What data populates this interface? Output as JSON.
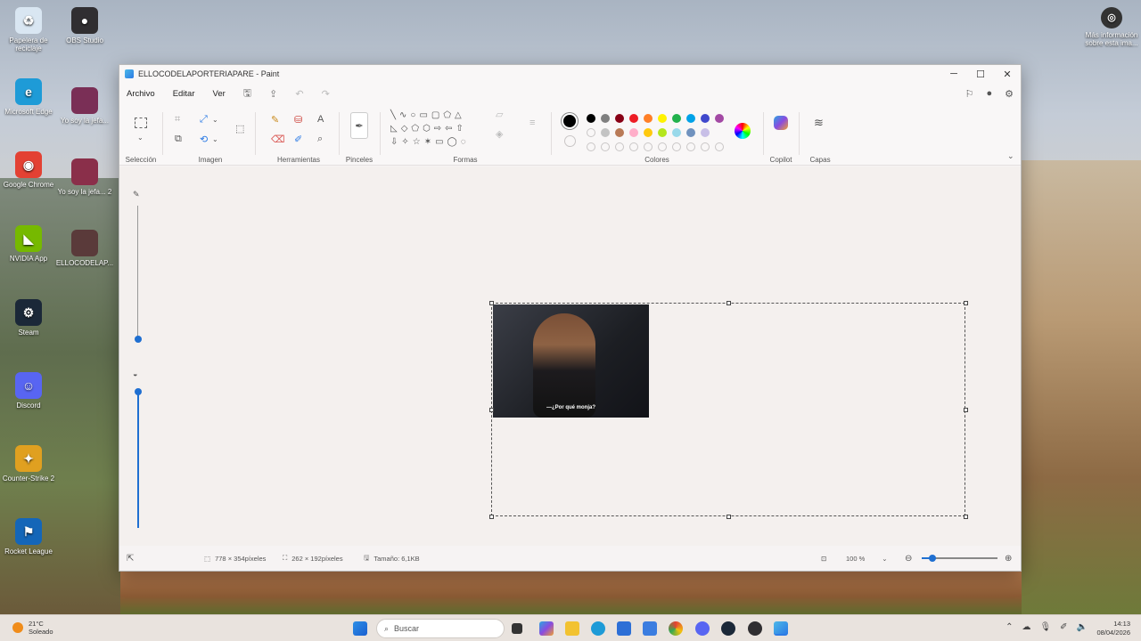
{
  "desktop": {
    "icons_left": [
      {
        "label": "Papelera de reciclaje",
        "icon": "recycle-bin-icon",
        "glyph": "♻",
        "color": "#d9e6f2"
      },
      {
        "label": "Microsoft Edge",
        "icon": "edge-icon",
        "glyph": "e",
        "color": "#1e9bd7"
      },
      {
        "label": "Google Chrome",
        "icon": "chrome-icon",
        "glyph": "◉",
        "color": "#e34133"
      },
      {
        "label": "NVIDIA App",
        "icon": "nvidia-icon",
        "glyph": "◣",
        "color": "#76b900"
      },
      {
        "label": "Steam",
        "icon": "steam-icon",
        "glyph": "⚙",
        "color": "#1b2838"
      },
      {
        "label": "Discord",
        "icon": "discord-icon",
        "glyph": "☺",
        "color": "#5865f2"
      },
      {
        "label": "Counter-Strike 2",
        "icon": "cs2-icon",
        "glyph": "✦",
        "color": "#e0a020"
      },
      {
        "label": "Rocket League",
        "icon": "rocket-league-icon",
        "glyph": "⚑",
        "color": "#1466b8"
      }
    ],
    "icons_col2": [
      {
        "label": "OBS Studio",
        "icon": "obs-icon",
        "glyph": "●",
        "color": "#302e31"
      },
      {
        "label": "Yo soy la jefa...",
        "icon": "video-thumbnail-icon",
        "glyph": "",
        "color": "#7a2f56"
      },
      {
        "label": "Yo soy la jefa... 2",
        "icon": "video-thumbnail-icon",
        "glyph": "",
        "color": "#8a2f4a"
      },
      {
        "label": "ELLOCODELAP...",
        "icon": "image-thumbnail-icon",
        "glyph": "",
        "color": "#5a3a3a"
      }
    ],
    "top_right_label": "Más información sobre esta ima..."
  },
  "window": {
    "title": "ELLOCODELAPORTERIAPARE - Paint",
    "controls": {
      "minimize": "─",
      "maximize": "☐",
      "close": "✕"
    }
  },
  "menu": {
    "items": [
      "Archivo",
      "Editar",
      "Ver"
    ]
  },
  "ribbon": {
    "groups": {
      "selection": "Selección",
      "image": "Imagen",
      "tools": "Herramientas",
      "brushes": "Pinceles",
      "shapes": "Formas",
      "colors": "Colores",
      "copilot": "Copilot",
      "layers": "Capas"
    },
    "palette_row1": [
      "#000000",
      "#7f7f7f",
      "#880015",
      "#ed1c24",
      "#ff7f27",
      "#fff200",
      "#22b14c",
      "#00a2e8",
      "#3f48cc",
      "#a349a4"
    ],
    "palette_row2": [
      "",
      "#c3c3c3",
      "#b97a57",
      "#ffaec9",
      "#ffc90e",
      "#b5e61d",
      "#99d9ea",
      "#7092be",
      "#c8bfe7"
    ],
    "active_color": "#000000"
  },
  "canvas": {
    "photo_subtitle": "—¿Por qué monja?"
  },
  "status": {
    "cursor": "",
    "canvas_size": "778 × 354píxeles",
    "selection_size": "262 × 192píxeles",
    "file_size": "Tamaño: 6,1KB",
    "zoom": "100 %"
  },
  "taskbar": {
    "weather_temp": "21°C",
    "weather_desc": "Soleado",
    "search_placeholder": "Buscar",
    "time": "14:13",
    "date": "08/04/2026"
  }
}
